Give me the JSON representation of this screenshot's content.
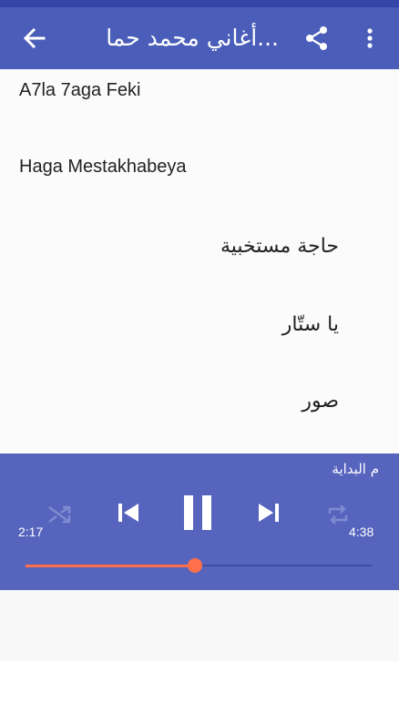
{
  "appbar": {
    "title": "أغاني محمد حما...",
    "back_icon": "arrow-back-icon",
    "share_icon": "share-icon",
    "more_icon": "more-vert-icon"
  },
  "songs": [
    {
      "label": "A7la 7aga Feki"
    },
    {
      "label": "Haga Mestakhabeya"
    },
    {
      "label": "حاجة مستخبية"
    },
    {
      "label": "يا ستّار"
    },
    {
      "label": "صور"
    }
  ],
  "player": {
    "now_playing": "م البداية",
    "elapsed": "2:17",
    "duration": "4:38",
    "progress_fraction": 0.49,
    "accent_color": "#ff6f4a",
    "bar_color": "#5664be",
    "icons": [
      "shuffle-icon",
      "skip-previous-icon",
      "pause-icon",
      "skip-next-icon",
      "repeat-icon"
    ]
  }
}
